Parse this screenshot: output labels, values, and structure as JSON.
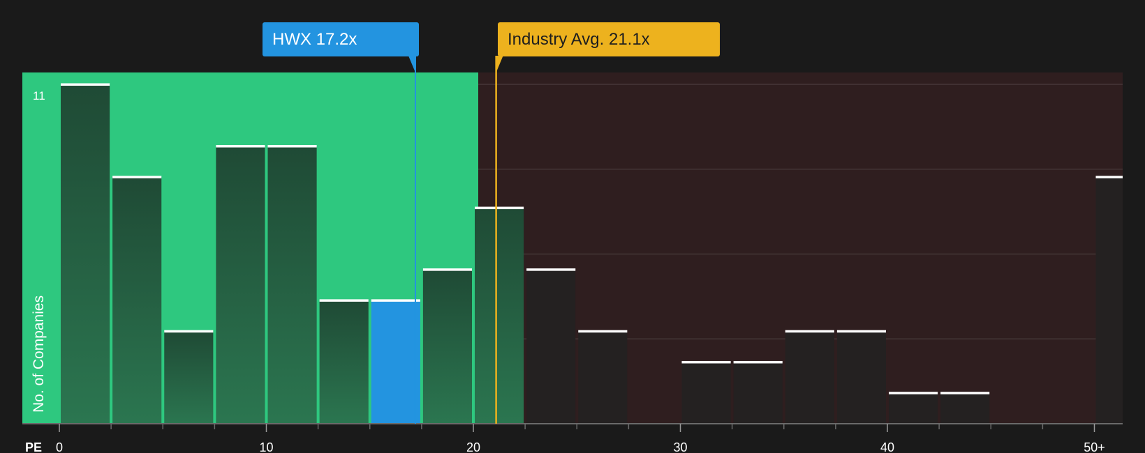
{
  "chart_data": {
    "type": "bar",
    "xlabel": "PE",
    "ylabel": "No. of Companies",
    "x_ticks": [
      "0",
      "10",
      "20",
      "30",
      "40",
      "50+"
    ],
    "x_tick_values": [
      0,
      10,
      20,
      30,
      40,
      50
    ],
    "y_tick_labels": [
      "11"
    ],
    "ylim": [
      0,
      11
    ],
    "bin_width": 2.5,
    "bins": [
      {
        "start": 0,
        "value": 11
      },
      {
        "start": 2.5,
        "value": 8
      },
      {
        "start": 5,
        "value": 3
      },
      {
        "start": 7.5,
        "value": 9
      },
      {
        "start": 10,
        "value": 9
      },
      {
        "start": 12.5,
        "value": 4
      },
      {
        "start": 15,
        "value": 4,
        "highlight": true
      },
      {
        "start": 17.5,
        "value": 5
      },
      {
        "start": 20,
        "value": 7
      },
      {
        "start": 22.5,
        "value": 5
      },
      {
        "start": 25,
        "value": 3
      },
      {
        "start": 27.5,
        "value": 0
      },
      {
        "start": 30,
        "value": 2
      },
      {
        "start": 32.5,
        "value": 2
      },
      {
        "start": 35,
        "value": 3
      },
      {
        "start": 37.5,
        "value": 3
      },
      {
        "start": 40,
        "value": 1
      },
      {
        "start": 42.5,
        "value": 1
      },
      {
        "start": 45,
        "value": 0
      },
      {
        "start": 47.5,
        "value": 0
      },
      {
        "start": 50,
        "value": 8
      }
    ],
    "markers": {
      "company": {
        "label": "HWX 17.2x",
        "value": 17.2
      },
      "industry": {
        "label": "Industry Avg. 21.1x",
        "value": 21.1
      }
    },
    "grid": true,
    "colors": {
      "below_region": "#2ec87f",
      "above_region": "#2f1e1f",
      "bar_in_green": "#245e40",
      "bar_in_dark": "#242121",
      "highlight_bar": "#2394e0",
      "company_marker": "#2394e0",
      "industry_marker": "#edb21e",
      "background": "#1a1a1a"
    }
  }
}
